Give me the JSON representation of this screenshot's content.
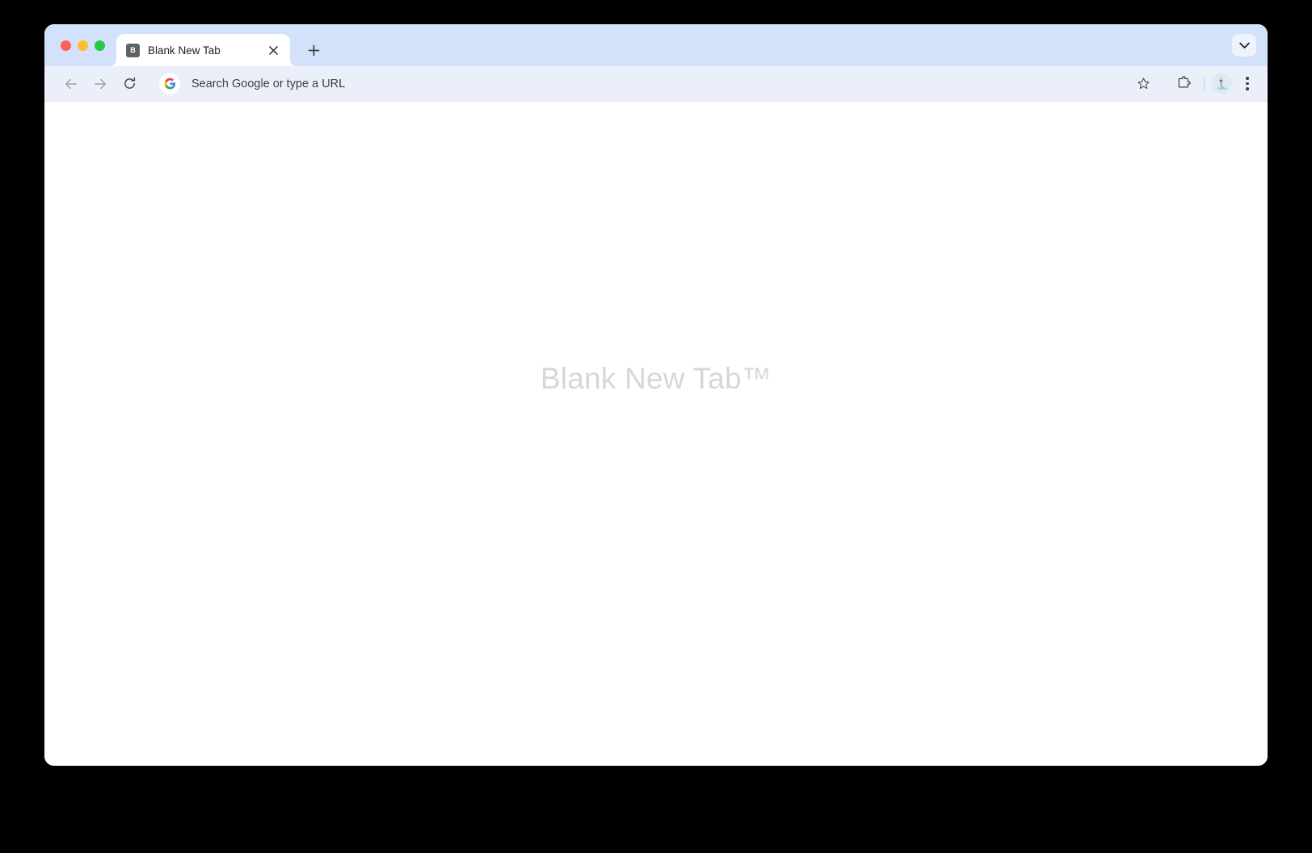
{
  "window": {
    "traffic_lights": [
      {
        "name": "close",
        "color": "#ff5f57"
      },
      {
        "name": "minimize",
        "color": "#febc2e"
      },
      {
        "name": "maximize",
        "color": "#28c840"
      }
    ]
  },
  "tabstrip": {
    "tabs": [
      {
        "favicon_letter": "B",
        "title": "Blank New Tab",
        "close_label": "×",
        "active": true
      }
    ],
    "new_tab_label": "+",
    "tab_search_icon": "chevron-down-icon"
  },
  "toolbar": {
    "back_icon": "arrow-left-icon",
    "forward_icon": "arrow-right-icon",
    "reload_icon": "reload-icon",
    "omnibox": {
      "leading_icon": "google-g-icon",
      "value": "",
      "placeholder": "Search Google or type a URL",
      "display_text": "Search Google or type a URL",
      "bookmark_icon": "star-icon"
    },
    "extensions_icon": "puzzle-piece-icon",
    "profile_icon": "avatar-icon",
    "menu_icon": "three-dot-menu-icon"
  },
  "page": {
    "watermark": "Blank New Tab™",
    "background": "#ffffff"
  },
  "colors": {
    "tabstrip_bg": "#d3e1fb",
    "toolbar_bg": "#eaeffa",
    "active_tab_bg": "#ffffff",
    "watermark_color": "#d7d7d7",
    "desktop_bg": "#000000"
  }
}
